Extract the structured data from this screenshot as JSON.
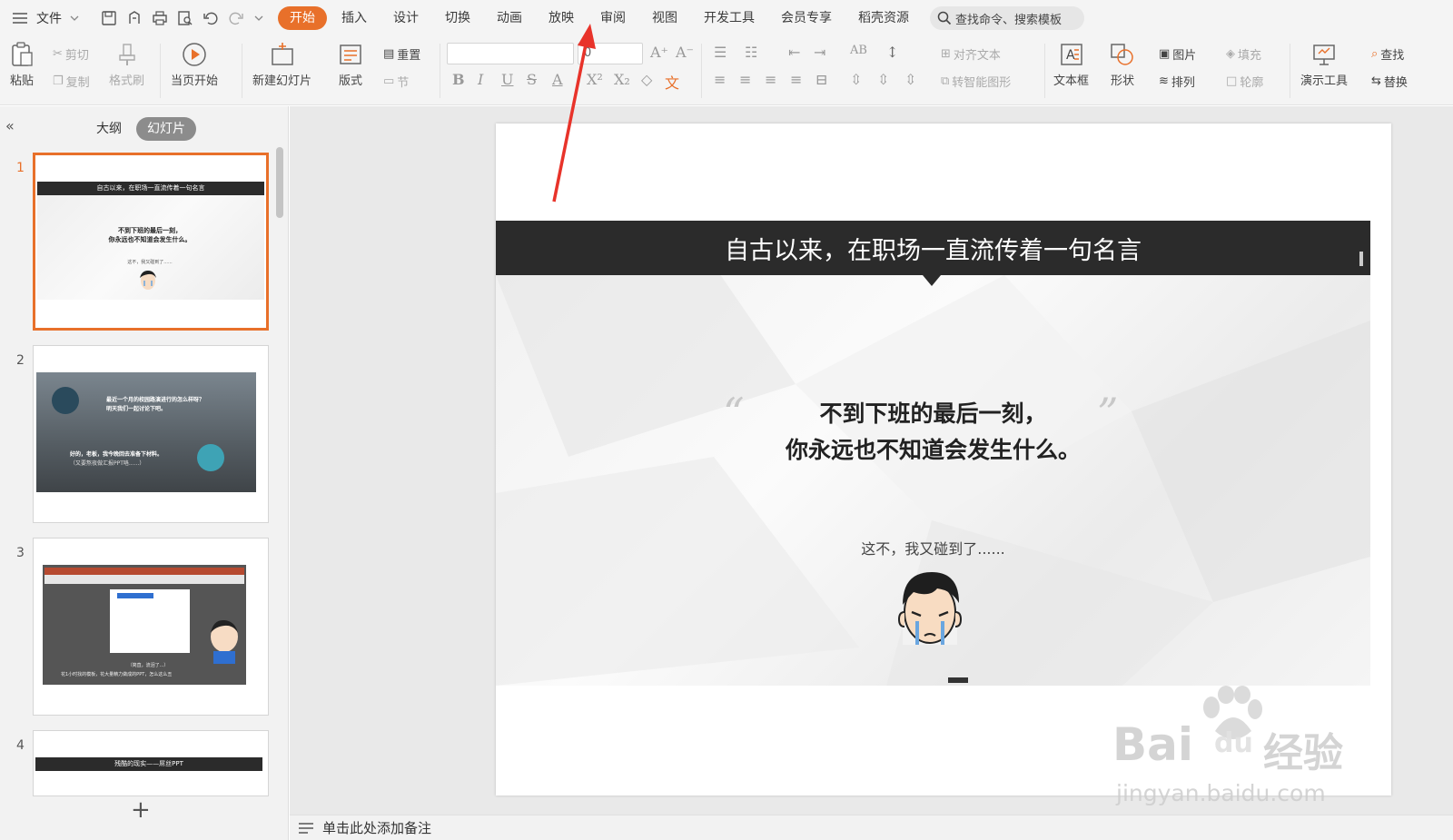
{
  "menubar": {
    "file_label": "文件",
    "tabs": [
      "开始",
      "插入",
      "设计",
      "切换",
      "动画",
      "放映",
      "审阅",
      "视图",
      "开发工具",
      "会员专享",
      "稻壳资源"
    ],
    "active_tab": "开始",
    "search_placeholder": "查找命令、搜索模板"
  },
  "ribbon": {
    "paste": "粘贴",
    "cut": "剪切",
    "copy": "复制",
    "format_painter": "格式刷",
    "play_current": "当页开始",
    "new_slide": "新建幻灯片",
    "layout": "版式",
    "reset": "重置",
    "section": "节",
    "align_text": "对齐文本",
    "smartart": "转智能图形",
    "textbox": "文本框",
    "shape": "形状",
    "picture": "图片",
    "arrange": "排列",
    "fill": "填充",
    "outline": "轮廓",
    "presenter_tools": "演示工具",
    "find": "查找",
    "replace": "替换",
    "font_size_value": "0"
  },
  "panel": {
    "tab_outline": "大纲",
    "tab_slides": "幻灯片",
    "slide_numbers": [
      "1",
      "2",
      "3",
      "4"
    ],
    "thumb1": {
      "title": "自古以来，在职场一直流传着一句名言",
      "line1": "不到下班的最后一刻，",
      "line2": "你永远也不知道会发生什么。",
      "caption": "这不，我又碰到了......"
    },
    "thumb2": {
      "bubble1a": "最近一个月的校园路演进行的怎么样呀？",
      "bubble1b": "明天我们一起讨论下吧。",
      "bubble2a": "好的，老板，我今晚回去准备下材料。",
      "bubble2b": "（又要熬夜做汇报PPT咯......）"
    },
    "thumb3": {
      "subtitle": "（简直，流泪了...）",
      "caption": "花1小时找的模板，花大量精力做成的PPT，怎么这么丑"
    },
    "thumb4": {
      "title": "残酷的现实——屌丝PPT"
    }
  },
  "slide": {
    "title": "自古以来，在职场一直流传着一句名言",
    "quote_line1": "不到下班的最后一刻，",
    "quote_line2": "你永远也不知道会发生什么。",
    "caption": "这不，我又碰到了......",
    "open_quote": "“",
    "close_quote": "”"
  },
  "notes": {
    "placeholder": "单击此处添加备注"
  },
  "watermark": {
    "brand": "Bai",
    "du": "du",
    "suffix": "经验",
    "url": "jingyan.baidu.com"
  },
  "colors": {
    "accent": "#e8702a",
    "banner": "#2b2b2b",
    "arrow": "#e8332a"
  }
}
